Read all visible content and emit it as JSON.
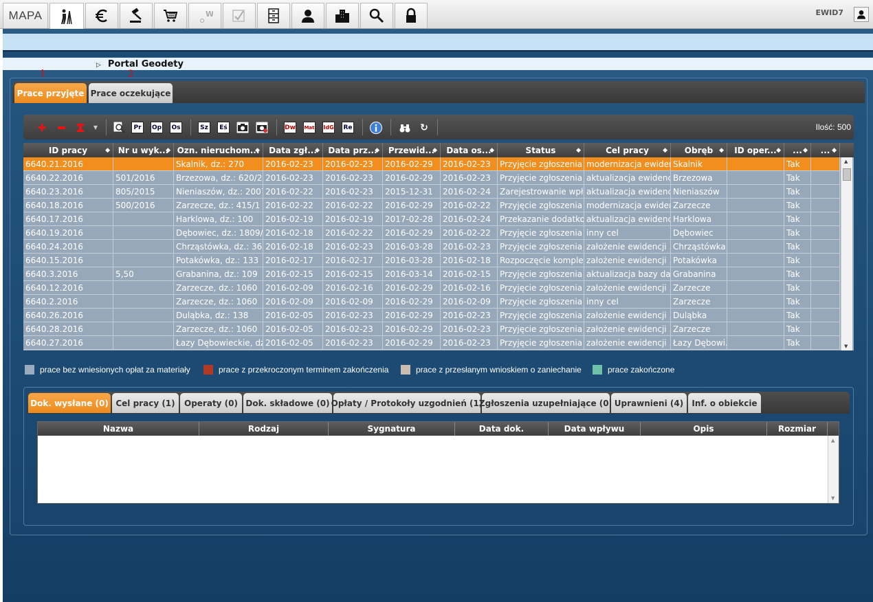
{
  "topbar": {
    "mapa_label": "MAPA",
    "tools": [
      "surveyor-icon",
      "euro-icon",
      "gavel-icon",
      "cart-icon",
      "w-icon",
      "checklist-icon",
      "cabinet-icon",
      "person-icon",
      "buildings-icon",
      "search-icon",
      "lock-icon"
    ],
    "user_label": "EWID7"
  },
  "portal": {
    "title": "Portal Geodety",
    "marker1": "1",
    "marker2": "2"
  },
  "main_tabs": [
    {
      "label": "Prace przyjęte"
    },
    {
      "label": "Prace oczekujące"
    }
  ],
  "toolbar": {
    "buttons": [
      "Pr",
      "Op",
      "Os",
      "Sz",
      "Eś",
      "Dw",
      "Mat",
      "IdG",
      "Re"
    ],
    "count_label": "Ilość: 500"
  },
  "grid": {
    "columns": [
      "ID pracy",
      "Nr u wyk...",
      "Ozn. nieruchom...",
      "Data zgł...",
      "Data prz...",
      "Przewid...",
      "Data os...",
      "Status",
      "Cel pracy",
      "Obręb",
      "ID oper...",
      "...",
      "..."
    ],
    "rows": [
      [
        "6640.21.2016",
        "",
        "Skalnik, dz.: 270",
        "2016-02-23",
        "2016-02-23",
        "2016-02-29",
        "2016-02-23",
        "Przyjęcie zgłoszenia ...",
        "modernizacja ewiden...",
        "Skalnik",
        "",
        "Tak",
        ""
      ],
      [
        "6640.22.2016",
        "501/2016",
        "Brzezowa, dz.: 620/2,...",
        "2016-02-23",
        "2016-02-23",
        "2016-02-29",
        "2016-02-23",
        "Przyjęcie zgłoszenia ...",
        "aktualizacja ewidencj...",
        "Brzezowa",
        "",
        "Tak",
        ""
      ],
      [
        "6640.23.2016",
        "805/2015",
        "Nieniaszów, dz.: 2007",
        "2016-02-22",
        "2016-02-23",
        "2015-12-31",
        "2016-02-24",
        "Zarejestrowanie wpła...",
        "aktualizacja ewidencj...",
        "Nieniaszów",
        "",
        "Tak",
        ""
      ],
      [
        "6640.18.2016",
        "500/2016",
        "Zarzecze, dz.: 415/1",
        "2016-02-22",
        "2016-02-22",
        "2016-02-29",
        "2016-02-22",
        "Przyjęcie zgłoszenia ...",
        "modernizacja ewiden...",
        "Zarzecze",
        "",
        "Tak",
        ""
      ],
      [
        "6640.17.2016",
        "",
        "Harklowa, dz.: 100",
        "2016-02-19",
        "2016-02-19",
        "2017-02-28",
        "2016-02-24",
        "Przekazanie dodatko...",
        "aktualizacja ewidencj...",
        "Harklowa",
        "",
        "Tak",
        ""
      ],
      [
        "6640.19.2016",
        "",
        "Dębowiec, dz.: 1809/3",
        "2016-02-18",
        "2016-02-22",
        "2016-02-29",
        "2016-02-22",
        "Przyjęcie zgłoszenia ...",
        "inny cel",
        "Dębowiec",
        "",
        "Tak",
        ""
      ],
      [
        "6640.24.2016",
        "",
        "Chrząstówka, dz.: 360/1",
        "2016-02-18",
        "2016-02-23",
        "2016-03-28",
        "2016-02-23",
        "Przyjęcie zgłoszenia ...",
        "założenie ewidencji ...",
        "Chrząstówka",
        "",
        "Tak",
        ""
      ],
      [
        "6640.15.2016",
        "",
        "Potakówka, dz.: 133",
        "2016-02-17",
        "2016-02-17",
        "2016-03-28",
        "2016-02-18",
        "Rozpoczęcie komple...",
        "założenie ewidencji ...",
        "Potakówka",
        "",
        "Tak",
        ""
      ],
      [
        "6640.3.2016",
        "5,50",
        "Grabanina, dz.: 109",
        "2016-02-15",
        "2016-02-15",
        "2016-03-14",
        "2016-02-15",
        "Przyjęcie zgłoszenia ...",
        "aktualizacja bazy dan...",
        "Grabanina",
        "",
        "Tak",
        ""
      ],
      [
        "6640.12.2016",
        "",
        "Zarzecze, dz.: 1060",
        "2016-02-09",
        "2016-02-16",
        "2016-02-29",
        "2016-02-16",
        "Przyjęcie zgłoszenia ...",
        "założenie ewidencji ...",
        "Zarzecze",
        "",
        "Tak",
        ""
      ],
      [
        "6640.2.2016",
        "",
        "Zarzecze, dz.: 1060",
        "2016-02-09",
        "2016-02-09",
        "2016-02-29",
        "2016-02-09",
        "Przyjęcie zgłoszenia ...",
        "inny cel",
        "Zarzecze",
        "",
        "Tak",
        ""
      ],
      [
        "6640.26.2016",
        "",
        "Duląbka, dz.: 138",
        "2016-02-05",
        "2016-02-23",
        "2016-02-29",
        "2016-02-23",
        "Przyjęcie zgłoszenia ...",
        "założenie ewidencji ...",
        "Duląbka",
        "",
        "Tak",
        ""
      ],
      [
        "6640.28.2016",
        "",
        "Zarzecze, dz.: 1060",
        "2016-02-05",
        "2016-02-23",
        "2016-02-29",
        "2016-02-23",
        "Przyjęcie zgłoszenia ...",
        "założenie ewidencji ...",
        "Zarzecze",
        "",
        "Tak",
        ""
      ],
      [
        "6640.27.2016",
        "",
        "Łazy Dębowieckie, dz....",
        "2016-02-05",
        "2016-02-23",
        "2016-02-29",
        "2016-02-23",
        "Przyjęcie zgłoszenia ...",
        "założenie ewidencji ...",
        "Łazy Dębowi...",
        "",
        "Tak",
        ""
      ]
    ]
  },
  "legend": [
    {
      "label": "prace bez wniesionych opłat za materiały",
      "color": "#9aabbd"
    },
    {
      "label": "prace z przekroczonym terminem zakończenia",
      "color": "#b03a24"
    },
    {
      "label": "prace z przesłanym wnioskiem o zaniechanie",
      "color": "#c9bcb0"
    },
    {
      "label": "prace zakończone",
      "color": "#6fc0a8"
    }
  ],
  "detail_tabs": [
    {
      "label": "Dok. wysłane (0)"
    },
    {
      "label": "Cel pracy (1)"
    },
    {
      "label": "Operaty (0)"
    },
    {
      "label": "Dok. składowe (0)"
    },
    {
      "label": "Opłaty / Protokoły uzgodnień (1)"
    },
    {
      "label": "Zgłoszenia uzupełniające (0)"
    },
    {
      "label": "Uprawnieni (4)"
    },
    {
      "label": "Inf. o obiekcie"
    }
  ],
  "detail_grid": {
    "columns": [
      "Nazwa",
      "Rodzaj",
      "Sygnatura",
      "Data dok.",
      "Data wpływu",
      "Opis",
      "Rozmiar"
    ]
  }
}
